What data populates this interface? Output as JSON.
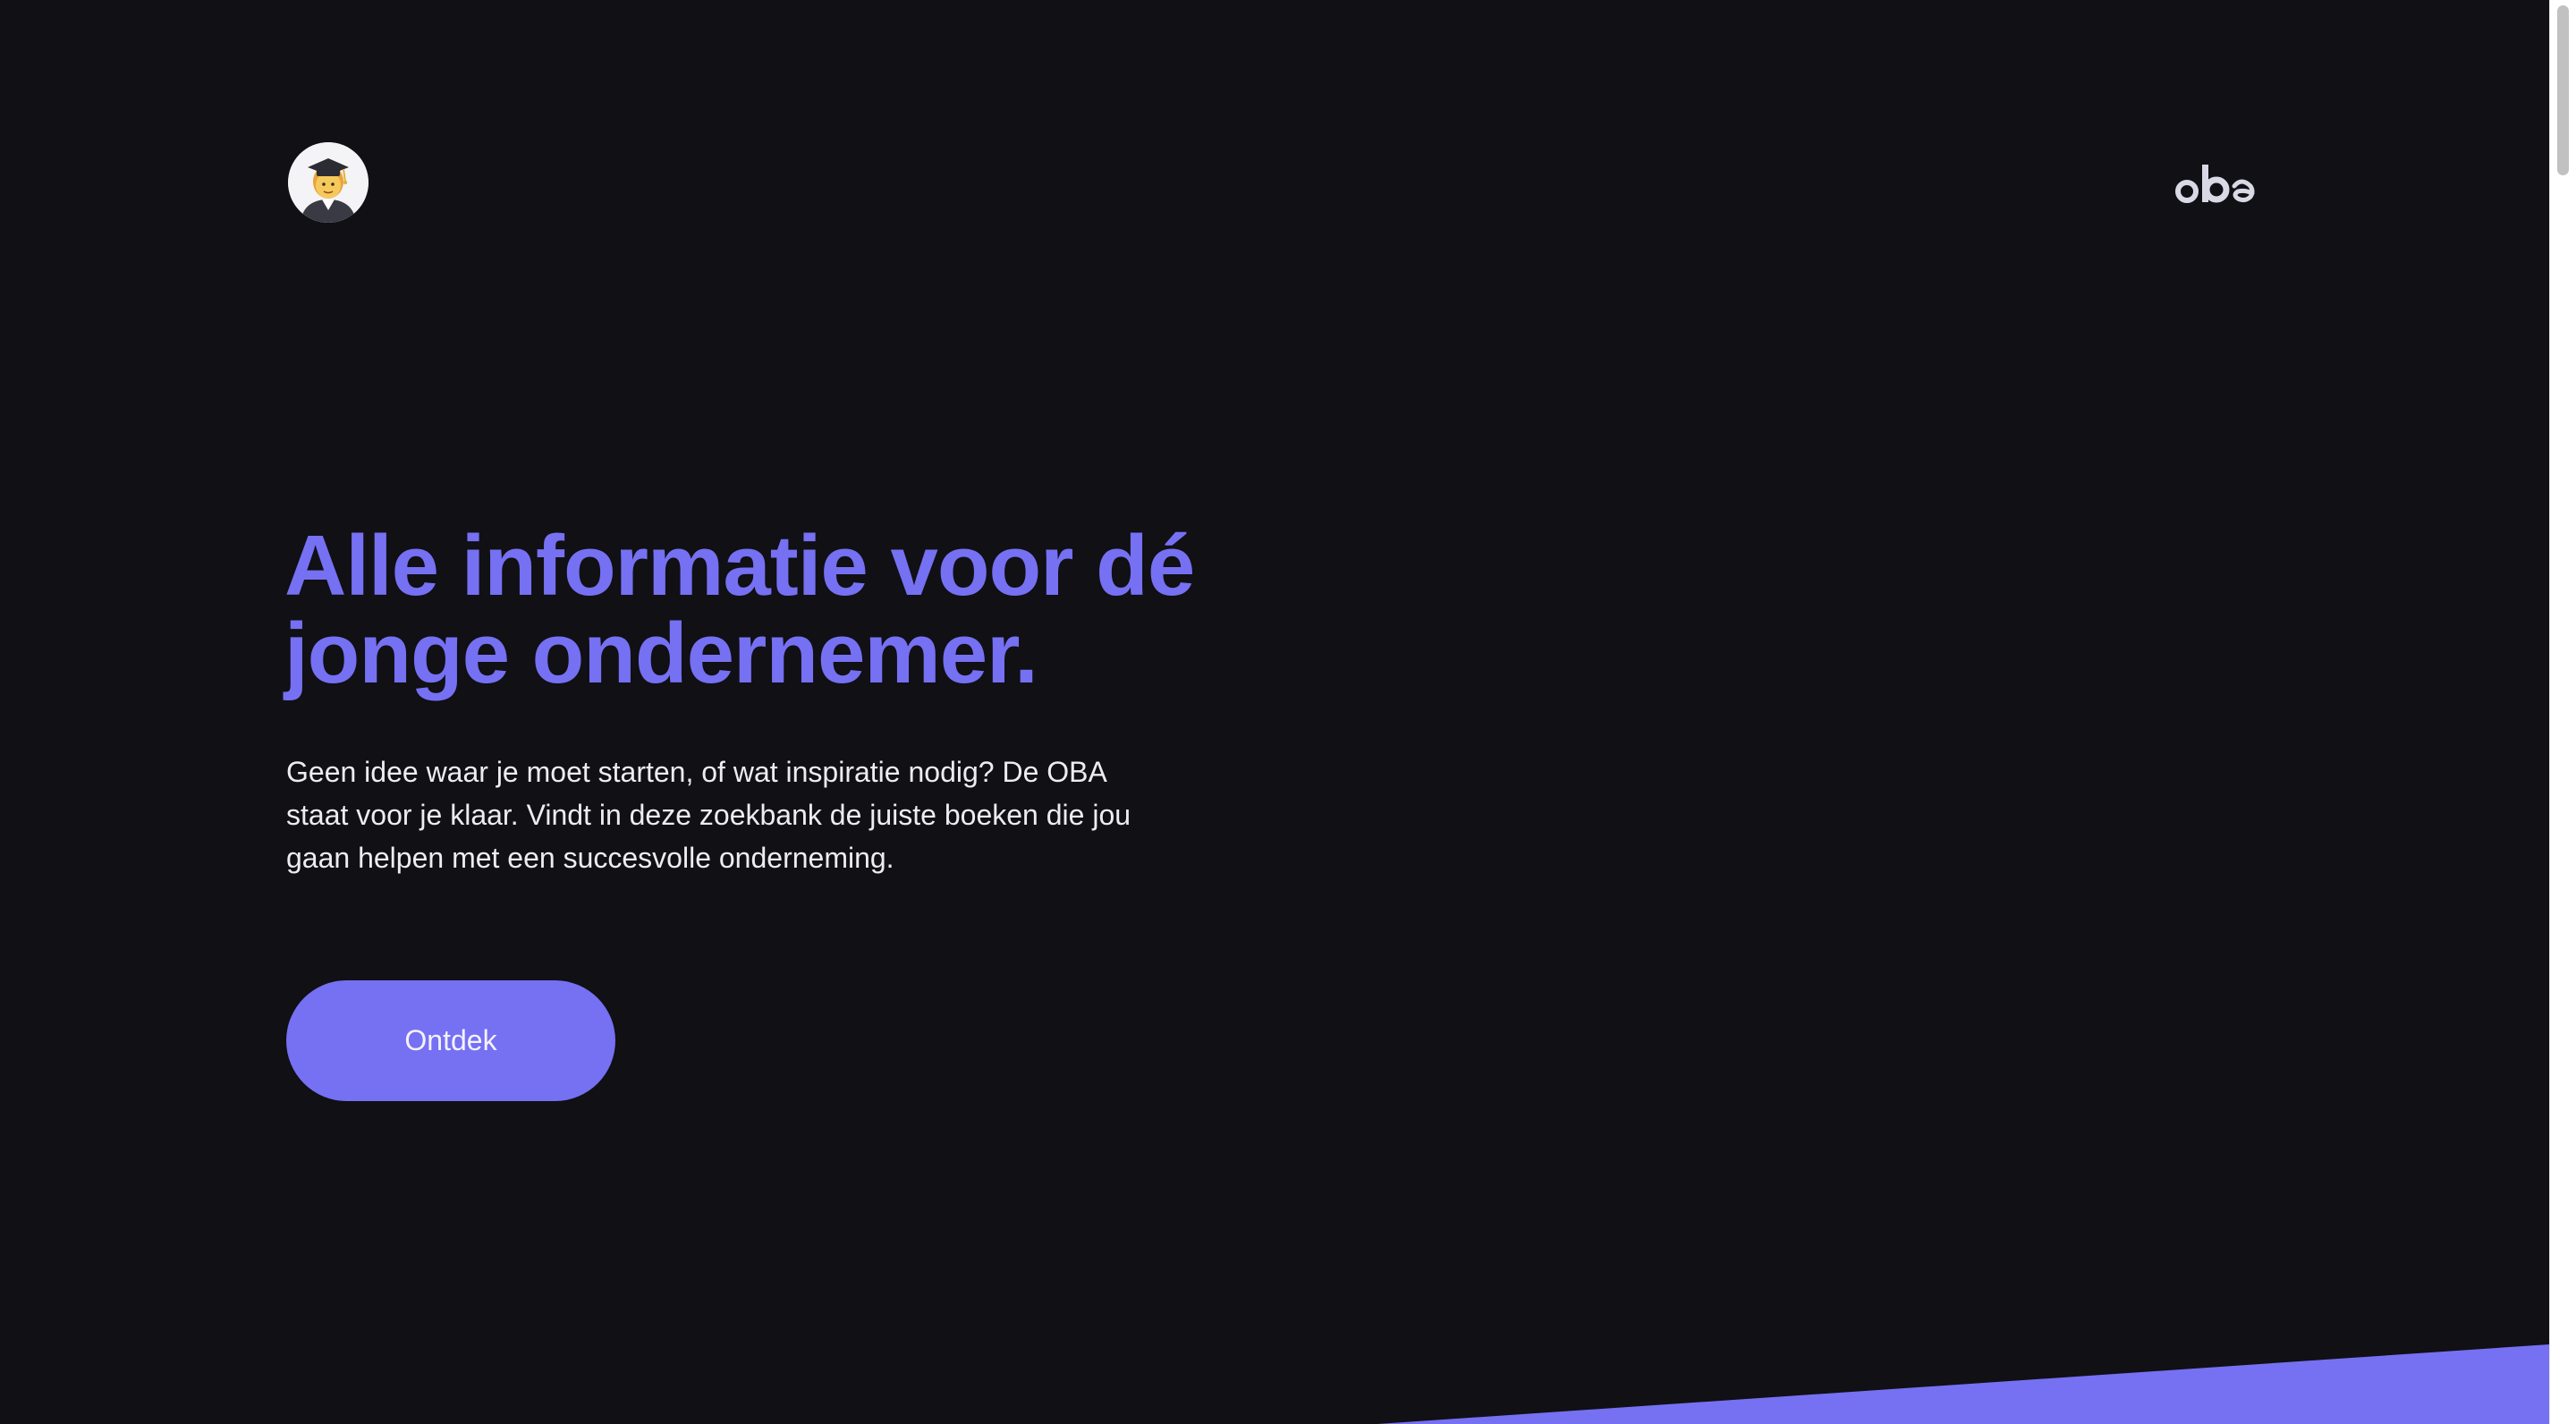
{
  "header": {
    "avatar_icon": "student-emoji-icon",
    "logo_text": "oba"
  },
  "hero": {
    "title_line1": "Alle informatie voor dé",
    "title_line2": "jonge ondernemer.",
    "description_line1": "Geen idee waar je moet starten, of wat inspiratie nodig? De OBA",
    "description_line2": "staat voor je klaar. Vindt in deze zoekbank de juiste boeken die jou",
    "description_line3": "gaan helpen met een succesvolle onderneming.",
    "cta_label": "Ontdek"
  },
  "colors": {
    "background": "#101015",
    "accent": "#7670f2",
    "text": "#ececf2"
  }
}
